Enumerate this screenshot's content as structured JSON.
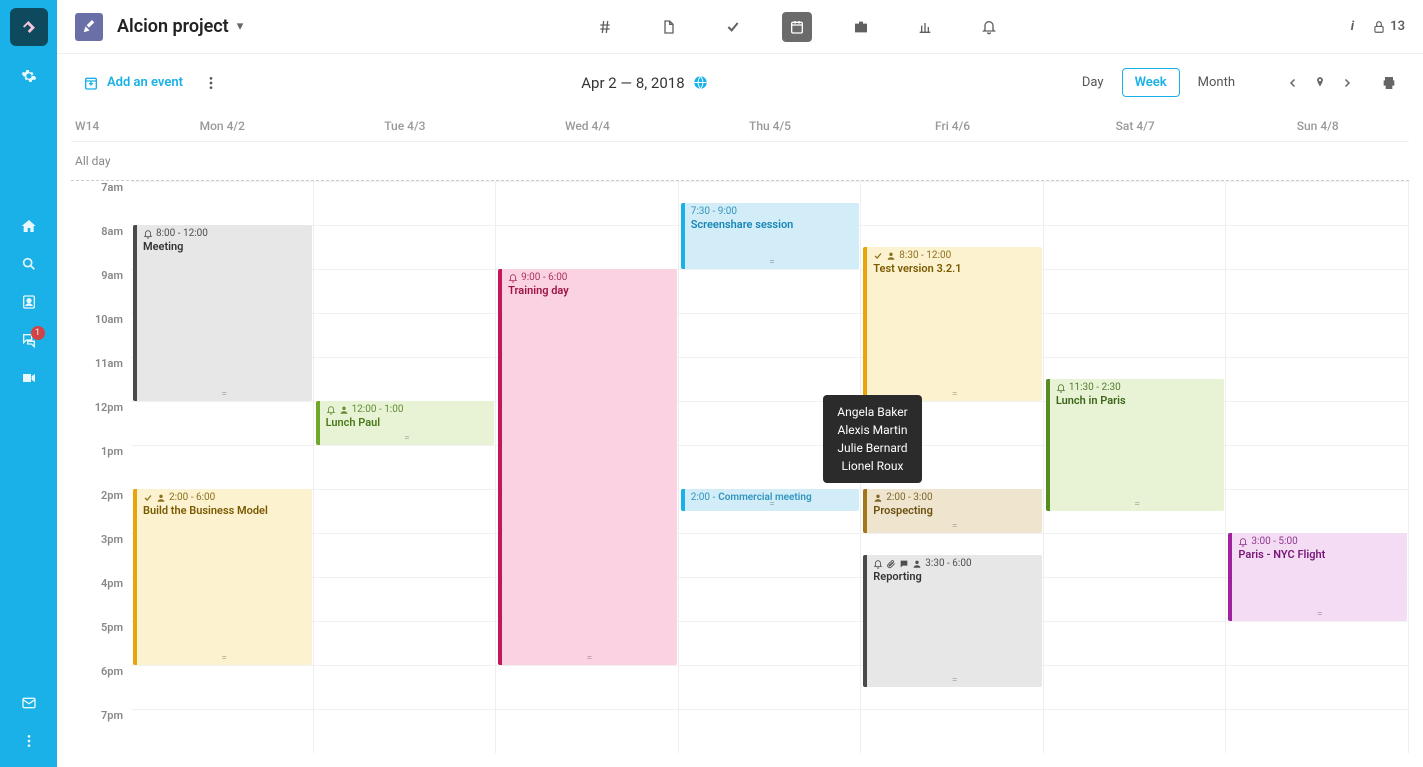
{
  "sidebar": {
    "chat_badge": "1"
  },
  "topbar": {
    "project_name": "Alcion project",
    "lock_count": "13"
  },
  "toolbar": {
    "add_event_label": "Add an event",
    "date_range": "Apr 2 — 8, 2018",
    "view_day": "Day",
    "view_week": "Week",
    "view_month": "Month"
  },
  "calendar": {
    "week_label": "W14",
    "days": [
      "Mon 4/2",
      "Tue 4/3",
      "Wed 4/4",
      "Thu 4/5",
      "Fri 4/6",
      "Sat 4/7",
      "Sun 4/8"
    ],
    "allday_label": "All day",
    "hours": [
      "7am",
      "8am",
      "9am",
      "10am",
      "11am",
      "12pm",
      "1pm",
      "2pm",
      "3pm",
      "4pm",
      "5pm",
      "6pm",
      "7pm"
    ]
  },
  "events": [
    {
      "day": 0,
      "start": 8,
      "end": 12,
      "time": "8:00 - 12:00",
      "title": "Meeting",
      "bg": "#e7e7e7",
      "border": "#4a4a4a",
      "text": "#333",
      "icons": [
        "bell"
      ]
    },
    {
      "day": 0,
      "start": 14,
      "end": 18,
      "time": "2:00 - 6:00",
      "title": "Build the Business Model",
      "bg": "#fcf2d0",
      "border": "#e9a40a",
      "text": "#7a5a00",
      "icons": [
        "check",
        "person"
      ]
    },
    {
      "day": 1,
      "start": 12,
      "end": 13,
      "time": "12:00 - 1:00",
      "title": "Lunch Paul",
      "bg": "#e7f3d4",
      "border": "#6fa82b",
      "text": "#4a7a1a",
      "icons": [
        "bell",
        "person"
      ]
    },
    {
      "day": 2,
      "start": 9,
      "end": 18,
      "time": "9:00 - 6:00",
      "title": "Training day",
      "bg": "#fbd2e1",
      "border": "#c2175b",
      "text": "#9c1447",
      "icons": [
        "bell"
      ]
    },
    {
      "day": 3,
      "start": 7.5,
      "end": 9,
      "time": "7:30 - 9:00",
      "title": "Screenshare session",
      "bg": "#d2ecf8",
      "border": "#1ab1e8",
      "text": "#1587b5",
      "icons": []
    },
    {
      "day": 3,
      "start": 14,
      "end": 14.5,
      "time": "2:00  -",
      "title": "Commercial meeting",
      "bg": "#d2ecf8",
      "border": "#1ab1e8",
      "text": "#1587b5",
      "icons": [],
      "inline": true
    },
    {
      "day": 4,
      "start": 8.5,
      "end": 12,
      "time": "8:30 - 12:00",
      "title": "Test version 3.2.1",
      "bg": "#fcf2d0",
      "border": "#e9a40a",
      "text": "#7a5a00",
      "icons": [
        "check",
        "person"
      ]
    },
    {
      "day": 4,
      "start": 14,
      "end": 15,
      "time": "2:00 - 3:00",
      "title": "Prospecting",
      "bg": "#efe5ce",
      "border": "#a0781a",
      "text": "#6b5010",
      "icons": [
        "person"
      ]
    },
    {
      "day": 4,
      "start": 15.5,
      "end": 18.5,
      "time": "3:30 - 6:00",
      "title": "Reporting",
      "bg": "#e7e7e7",
      "border": "#4a4a4a",
      "text": "#333",
      "icons": [
        "bell",
        "clip",
        "comment",
        "person"
      ]
    },
    {
      "day": 5,
      "start": 11.5,
      "end": 14.5,
      "time": "11:30 - 2:30",
      "title": "Lunch in Paris",
      "bg": "#e7f3d4",
      "border": "#568b22",
      "text": "#3d6418",
      "icons": [
        "bell"
      ]
    },
    {
      "day": 6,
      "start": 15,
      "end": 17,
      "time": "3:00 - 5:00",
      "title": "Paris - NYC Flight",
      "bg": "#f4dcf4",
      "border": "#a020a0",
      "text": "#7a187a",
      "icons": [
        "bell"
      ]
    }
  ],
  "tooltip": {
    "lines": [
      "Angela Baker",
      "Alexis Martin",
      "Julie Bernard",
      "Lionel Roux"
    ]
  }
}
